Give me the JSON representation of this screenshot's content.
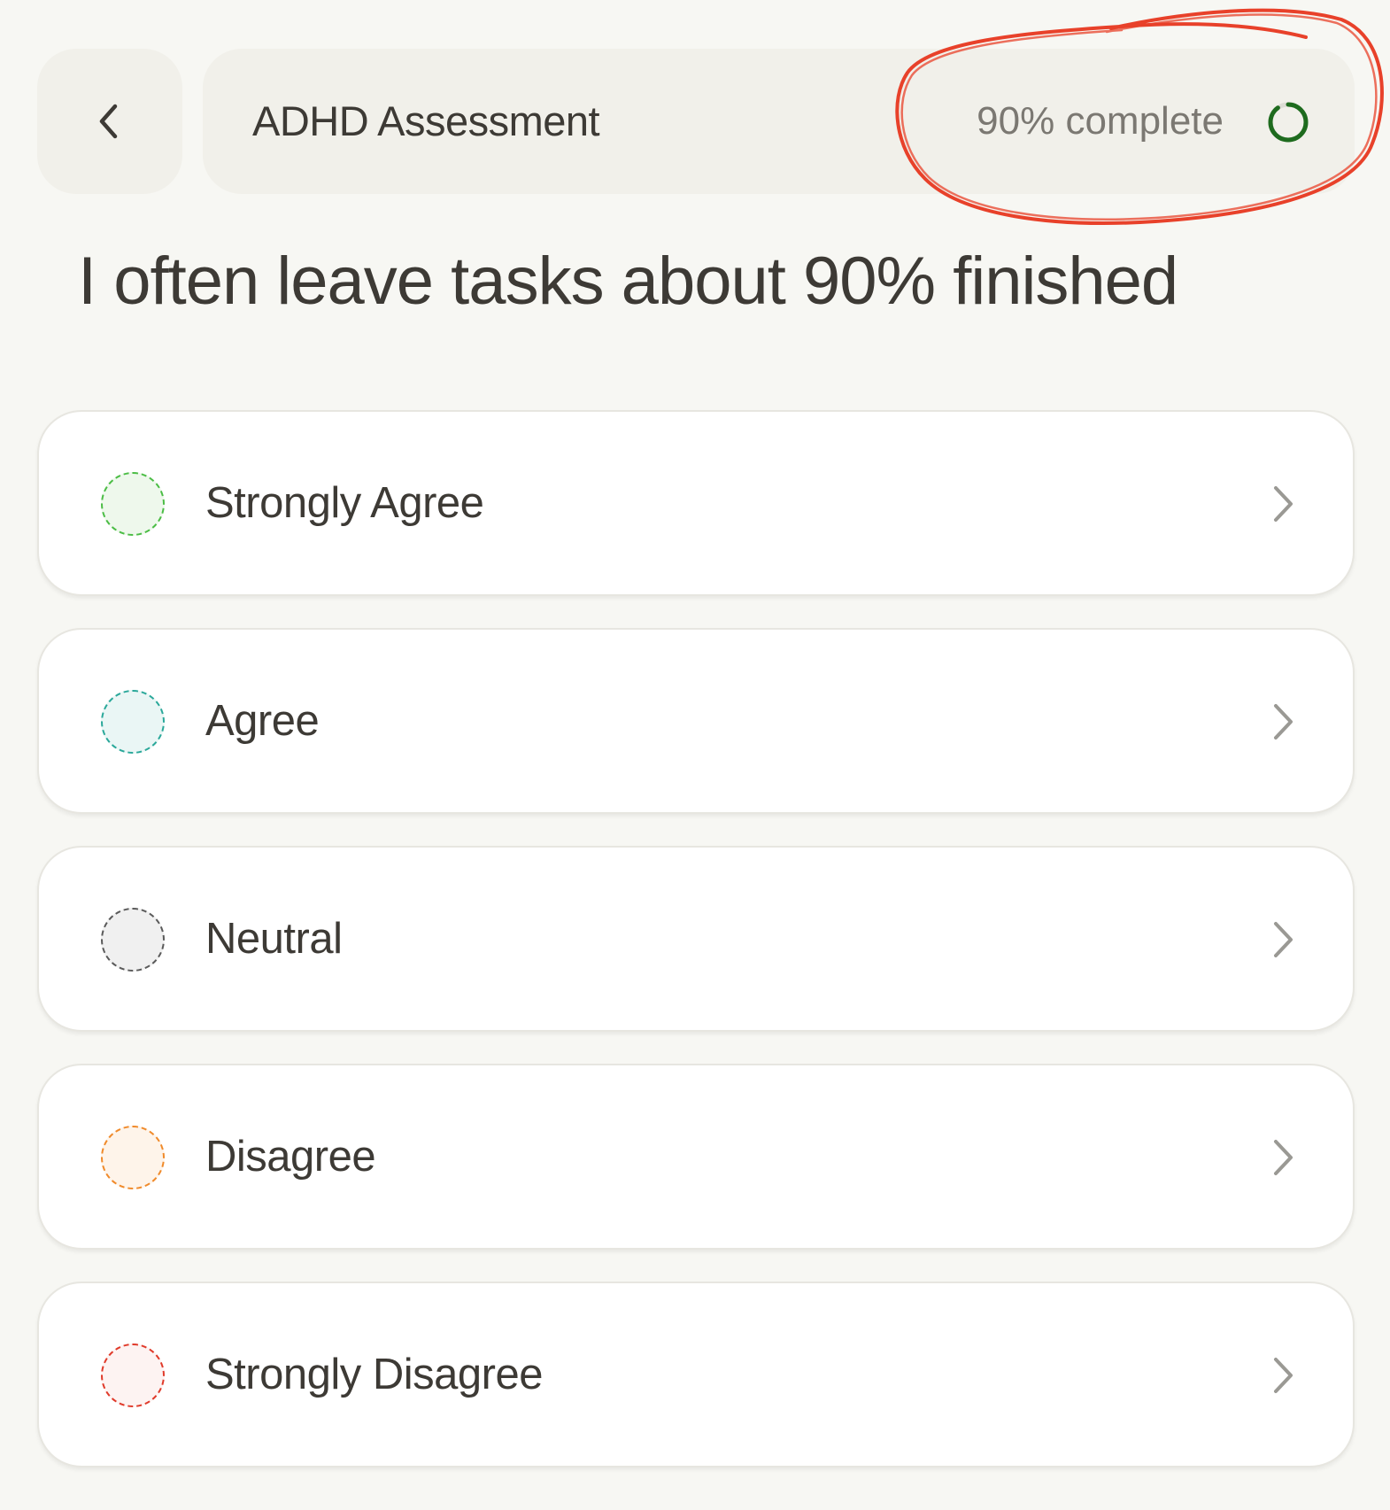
{
  "header": {
    "back_icon": "chevron-left-icon",
    "title": "ADHD Assessment",
    "progress_text": "90% complete",
    "progress_value": 0.9,
    "progress_color": "#1e6b1e"
  },
  "question": {
    "text": "I often leave tasks about 90% finished"
  },
  "options": [
    {
      "label": "Strongly Agree",
      "color": "#4bbd45",
      "fill": "#eef8ec"
    },
    {
      "label": "Agree",
      "color": "#2aa89a",
      "fill": "#eaf6f5"
    },
    {
      "label": "Neutral",
      "color": "#5a5a5a",
      "fill": "#f0f0f0"
    },
    {
      "label": "Disagree",
      "color": "#f08a2a",
      "fill": "#fef4ea"
    },
    {
      "label": "Strongly Disagree",
      "color": "#e03a2a",
      "fill": "#fdf3f2"
    }
  ],
  "option_icon": "chevron-right-icon",
  "annotation_color": "#e8412a"
}
